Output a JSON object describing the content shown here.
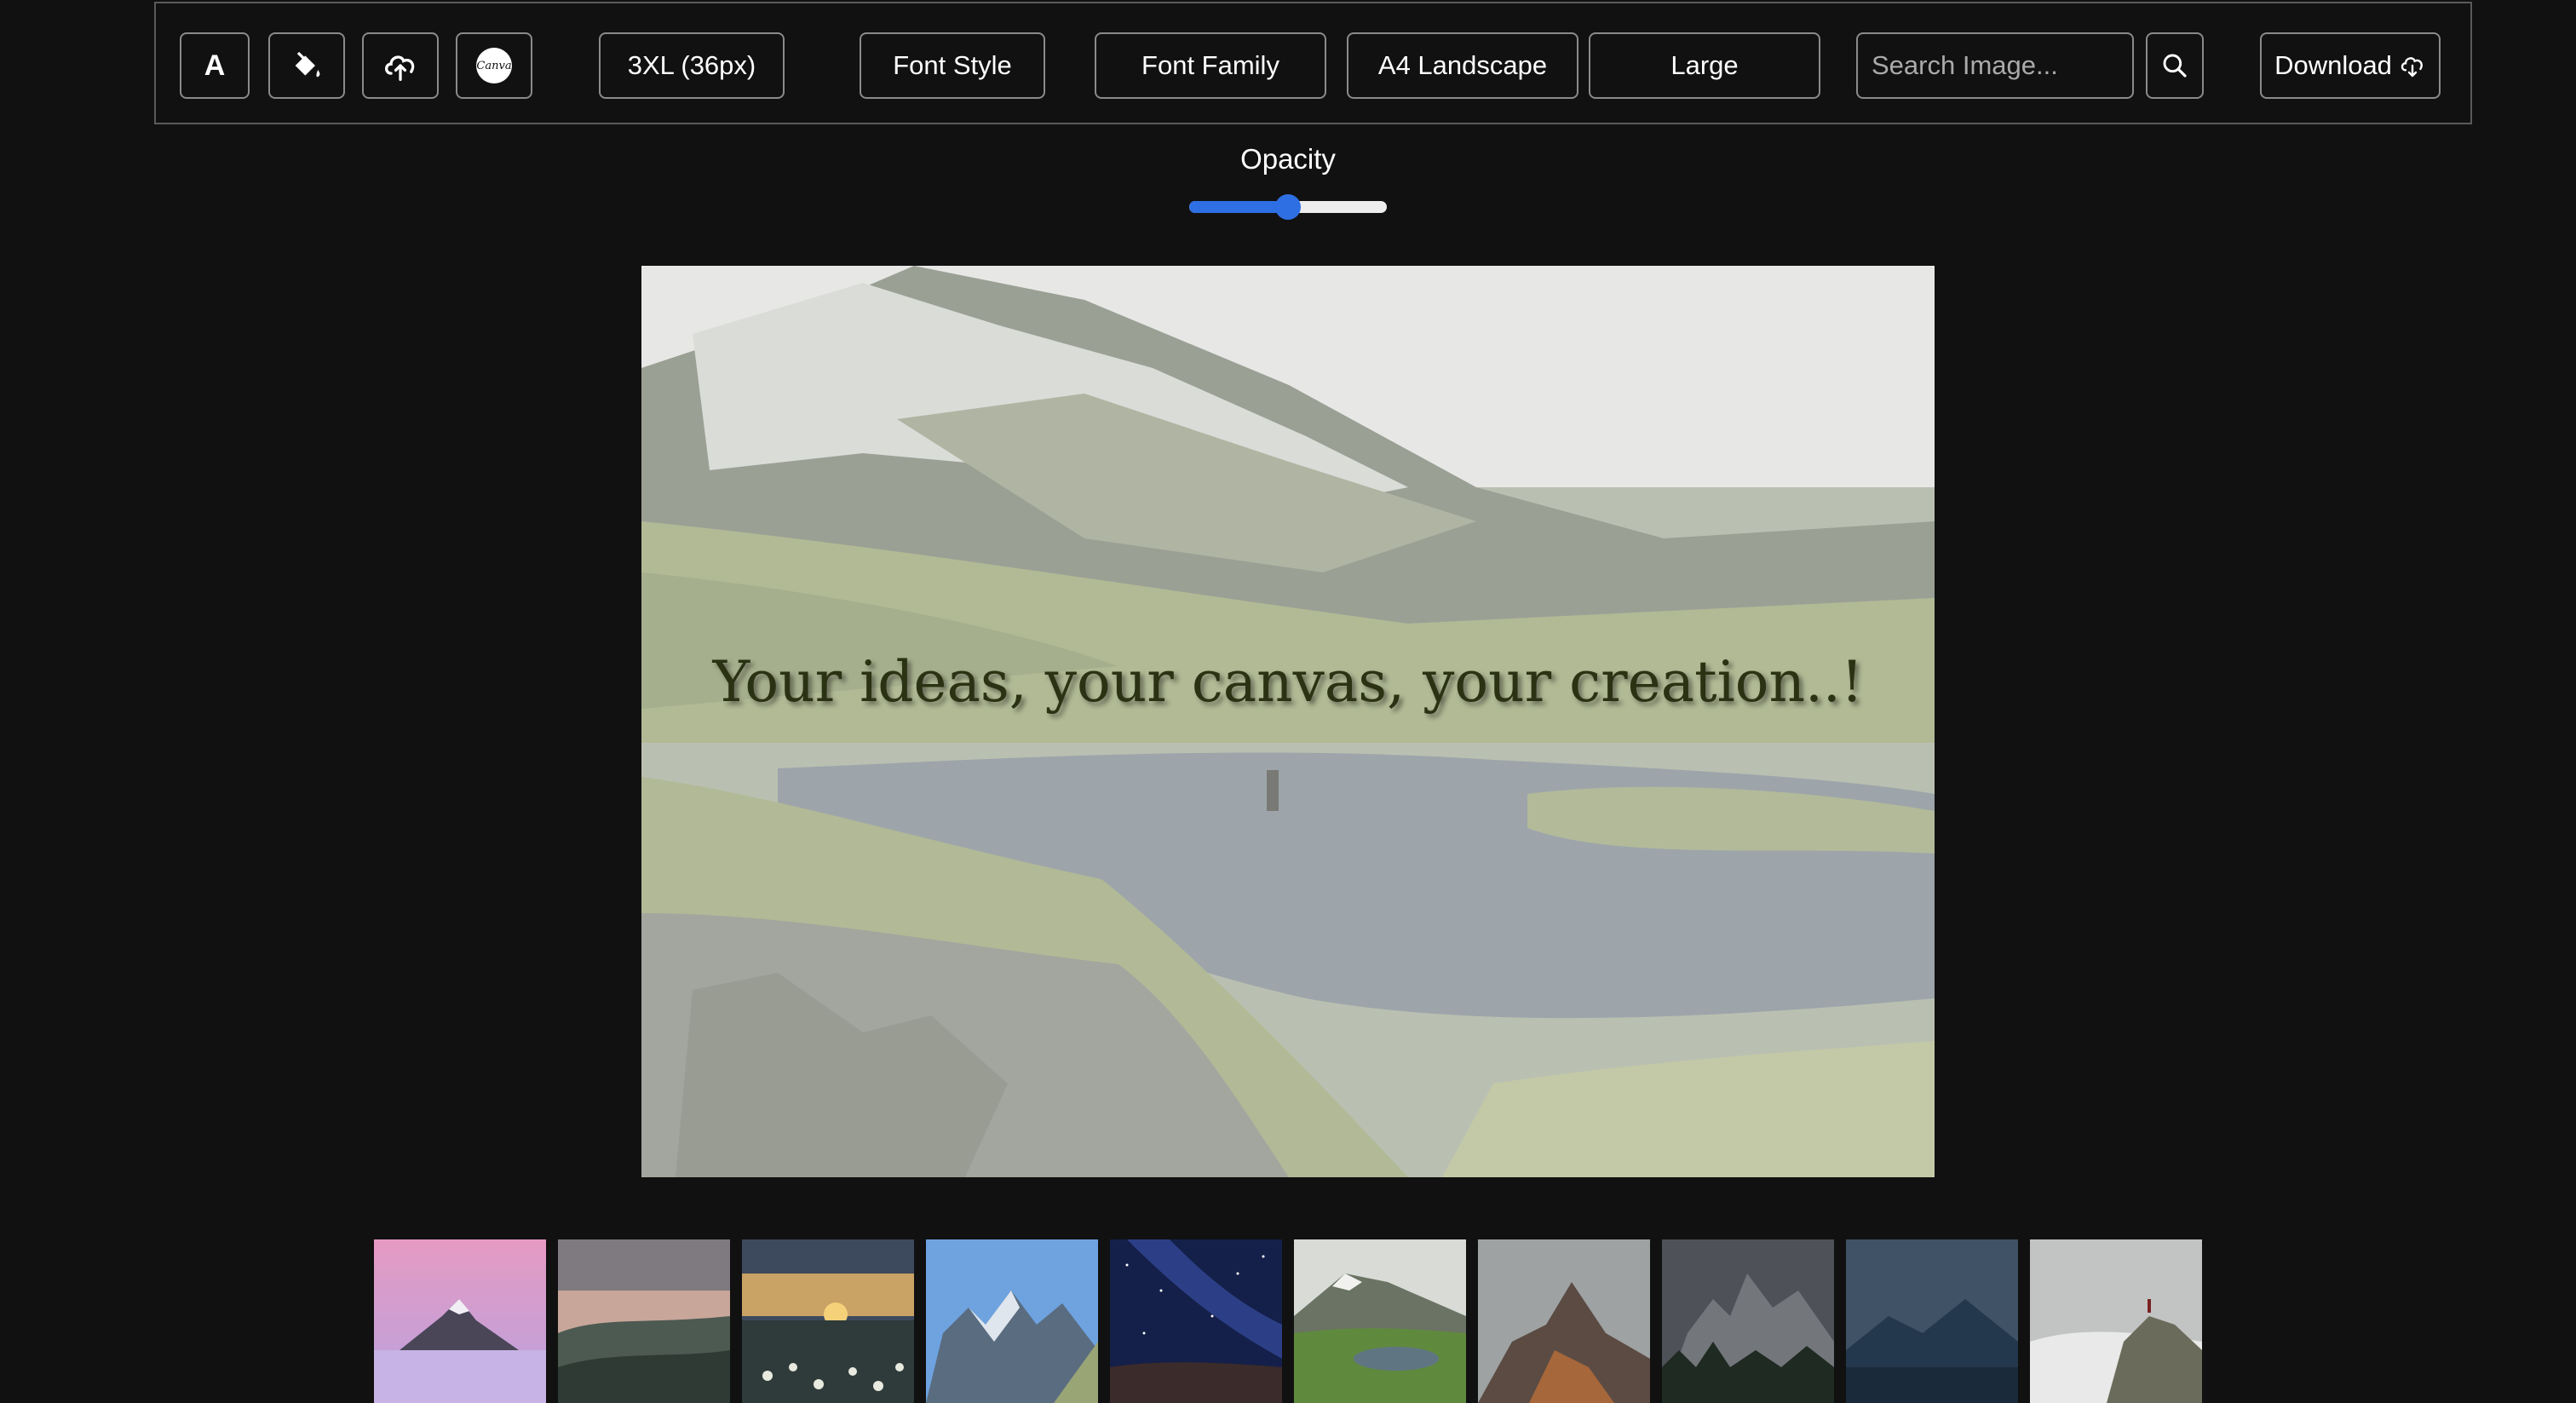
{
  "toolbar": {
    "text_tool_label": "A",
    "font_size_label": "3XL (36px)",
    "font_style_label": "Font Style",
    "font_family_label": "Font Family",
    "page_size_label": "A4 Landscape",
    "size_label": "Large",
    "search_placeholder": "Search Image...",
    "download_label": "Download",
    "canva_logo_text": "Canva"
  },
  "opacity": {
    "label": "Opacity",
    "value": 0.5,
    "accent": "#2f6fe4"
  },
  "canvas": {
    "text": "Your ideas, your canvas, your creation..!",
    "text_color": "#2b3214"
  },
  "thumbnails": [
    {
      "name": "pink-sky-peak"
    },
    {
      "name": "dusk-hills"
    },
    {
      "name": "sunset-flowers"
    },
    {
      "name": "blue-dolomites"
    },
    {
      "name": "milky-way"
    },
    {
      "name": "green-valley-lake"
    },
    {
      "name": "orange-peak"
    },
    {
      "name": "dark-spires"
    },
    {
      "name": "blue-lake-mountains"
    },
    {
      "name": "cliff-above-clouds"
    }
  ],
  "icons": [
    "text-icon",
    "paint-bucket-icon",
    "upload-cloud-icon",
    "canva-icon",
    "search-icon",
    "download-cloud-icon"
  ]
}
